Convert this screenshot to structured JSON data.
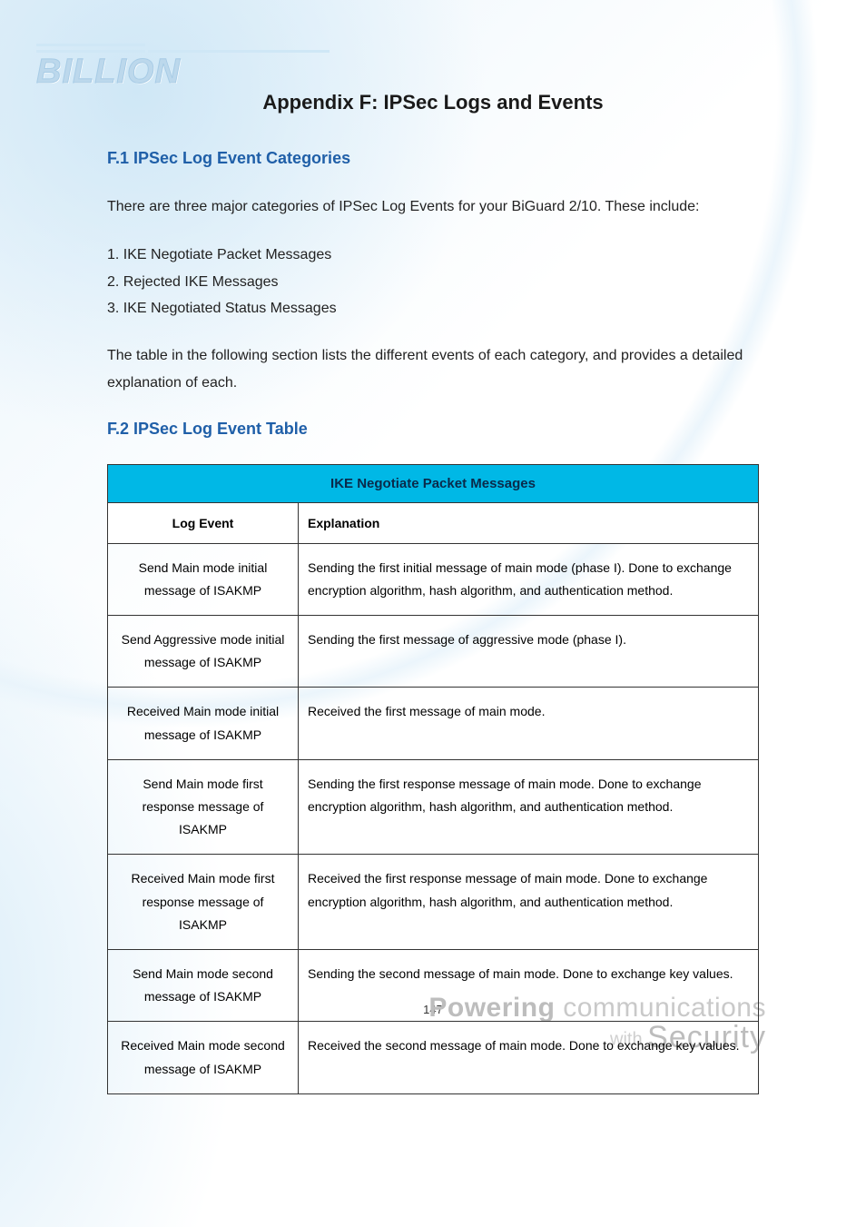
{
  "logo": {
    "text": "BILLION"
  },
  "title": "Appendix F: IPSec Logs and Events",
  "section1": {
    "heading": "F.1   IPSec Log Event Categories",
    "intro": "There are three major categories of IPSec Log Events for your BiGuard 2/10. These include:",
    "items": [
      "1. IKE Negotiate Packet Messages",
      "2. Rejected IKE Messages",
      "3. IKE Negotiated Status Messages"
    ],
    "outro": "The table in the following section lists the different events of each category, and provides a detailed explanation of each."
  },
  "section2": {
    "heading": "F.2   IPSec Log Event Table"
  },
  "chart_data": {
    "type": "table",
    "category_header": "IKE Negotiate Packet Messages",
    "columns": [
      "Log Event",
      "Explanation"
    ],
    "rows": [
      {
        "event": "Send Main mode initial message of ISAKMP",
        "explanation": "Sending the first initial message of main mode (phase I). Done to exchange encryption algorithm, hash algorithm, and authentication method."
      },
      {
        "event": "Send Aggressive mode initial message of ISAKMP",
        "explanation": "Sending the first message of aggressive mode (phase I)."
      },
      {
        "event": "Received Main mode initial message of ISAKMP",
        "explanation": "Received the first message of main mode."
      },
      {
        "event": "Send Main mode first response message of ISAKMP",
        "explanation": "Sending the first response message of main mode. Done to exchange encryption algorithm, hash algorithm, and authentication method."
      },
      {
        "event": "Received Main mode first response message of ISAKMP",
        "explanation": "Received the first response message of main mode. Done to exchange encryption algorithm, hash algorithm, and authentication method."
      },
      {
        "event": "Send Main mode second message of ISAKMP",
        "explanation": "Sending the second message of main mode. Done to exchange key values."
      },
      {
        "event": "Received Main mode second message of ISAKMP",
        "explanation": "Received the second message of main mode. Done to exchange key values."
      }
    ]
  },
  "page_number": "147",
  "footer": {
    "line1_strong": "Powering",
    "line1_rest": " communications",
    "line2_with": "with ",
    "line2_sec": "Security"
  }
}
